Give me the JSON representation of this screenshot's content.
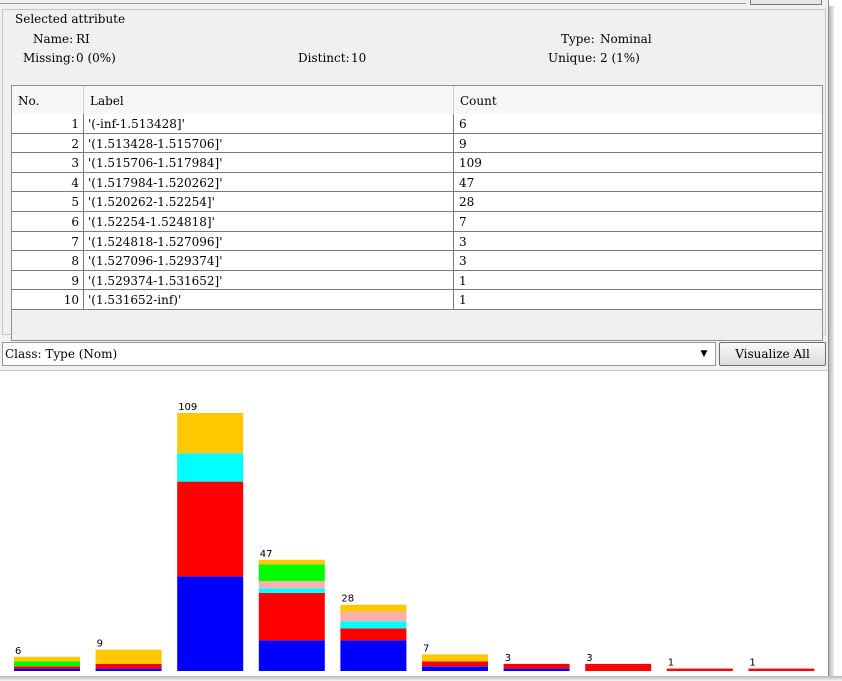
{
  "selected_attribute": {
    "title": "Selected attribute",
    "name_label": "Name:",
    "name_value": "RI",
    "missing_label": "Missing:",
    "missing_value": "0 (0%)",
    "distinct_label": "Distinct:",
    "distinct_value": "10",
    "type_label": "Type:",
    "type_value": "Nominal",
    "unique_label": "Unique:",
    "unique_value": "2 (1%)"
  },
  "table": {
    "headers": [
      "No.",
      "Label",
      "Count"
    ],
    "rows": [
      {
        "no": "1",
        "label": "'(-inf-1.513428]'",
        "count": "6"
      },
      {
        "no": "2",
        "label": "'(1.513428-1.515706]'",
        "count": "9"
      },
      {
        "no": "3",
        "label": "'(1.515706-1.517984]'",
        "count": "109"
      },
      {
        "no": "4",
        "label": "'(1.517984-1.520262]'",
        "count": "47"
      },
      {
        "no": "5",
        "label": "'(1.520262-1.52254]'",
        "count": "28"
      },
      {
        "no": "6",
        "label": "'(1.52254-1.524818]'",
        "count": "7"
      },
      {
        "no": "7",
        "label": "'(1.524818-1.527096]'",
        "count": "3"
      },
      {
        "no": "8",
        "label": "'(1.527096-1.529374]'",
        "count": "3"
      },
      {
        "no": "9",
        "label": "'(1.529374-1.531652]'",
        "count": "1"
      },
      {
        "no": "10",
        "label": "'(1.531652-inf)'",
        "count": "1"
      }
    ]
  },
  "class_selector": {
    "value": "Class: Type (Nom)"
  },
  "visualize_all_label": "Visualize All",
  "class_colors": {
    "blue": "#0000ff",
    "red": "#ff0000",
    "cyan": "#00ffff",
    "pink": "#ffafaf",
    "green": "#00ff00",
    "orange": "#ffc800"
  },
  "chart_data": {
    "type": "bar",
    "stacked": true,
    "categories": [
      "'(-inf-1.513428]'",
      "'(1.513428-1.515706]'",
      "'(1.515706-1.517984]'",
      "'(1.517984-1.520262]'",
      "'(1.520262-1.52254]'",
      "'(1.52254-1.524818]'",
      "'(1.524818-1.527096]'",
      "'(1.527096-1.529374]'",
      "'(1.529374-1.531652]'",
      "'(1.531652-inf)'"
    ],
    "totals": [
      6,
      9,
      109,
      47,
      28,
      7,
      3,
      3,
      1,
      1
    ],
    "series": [
      {
        "color": "blue",
        "values": [
          1,
          1,
          40,
          13,
          13,
          2,
          1,
          0,
          0,
          0
        ]
      },
      {
        "color": "red",
        "values": [
          1,
          2,
          40,
          20,
          5,
          2,
          2,
          3,
          1,
          1
        ]
      },
      {
        "color": "cyan",
        "values": [
          0,
          0,
          12,
          2,
          3,
          0,
          0,
          0,
          0,
          0
        ]
      },
      {
        "color": "pink",
        "values": [
          0,
          0,
          0,
          3,
          4,
          0,
          0,
          0,
          0,
          0
        ]
      },
      {
        "color": "green",
        "values": [
          2,
          0,
          0,
          7,
          0,
          0,
          0,
          0,
          0,
          0
        ]
      },
      {
        "color": "orange",
        "values": [
          2,
          6,
          17,
          2,
          3,
          3,
          0,
          0,
          0,
          0
        ]
      }
    ],
    "ylim": [
      0,
      109
    ]
  }
}
